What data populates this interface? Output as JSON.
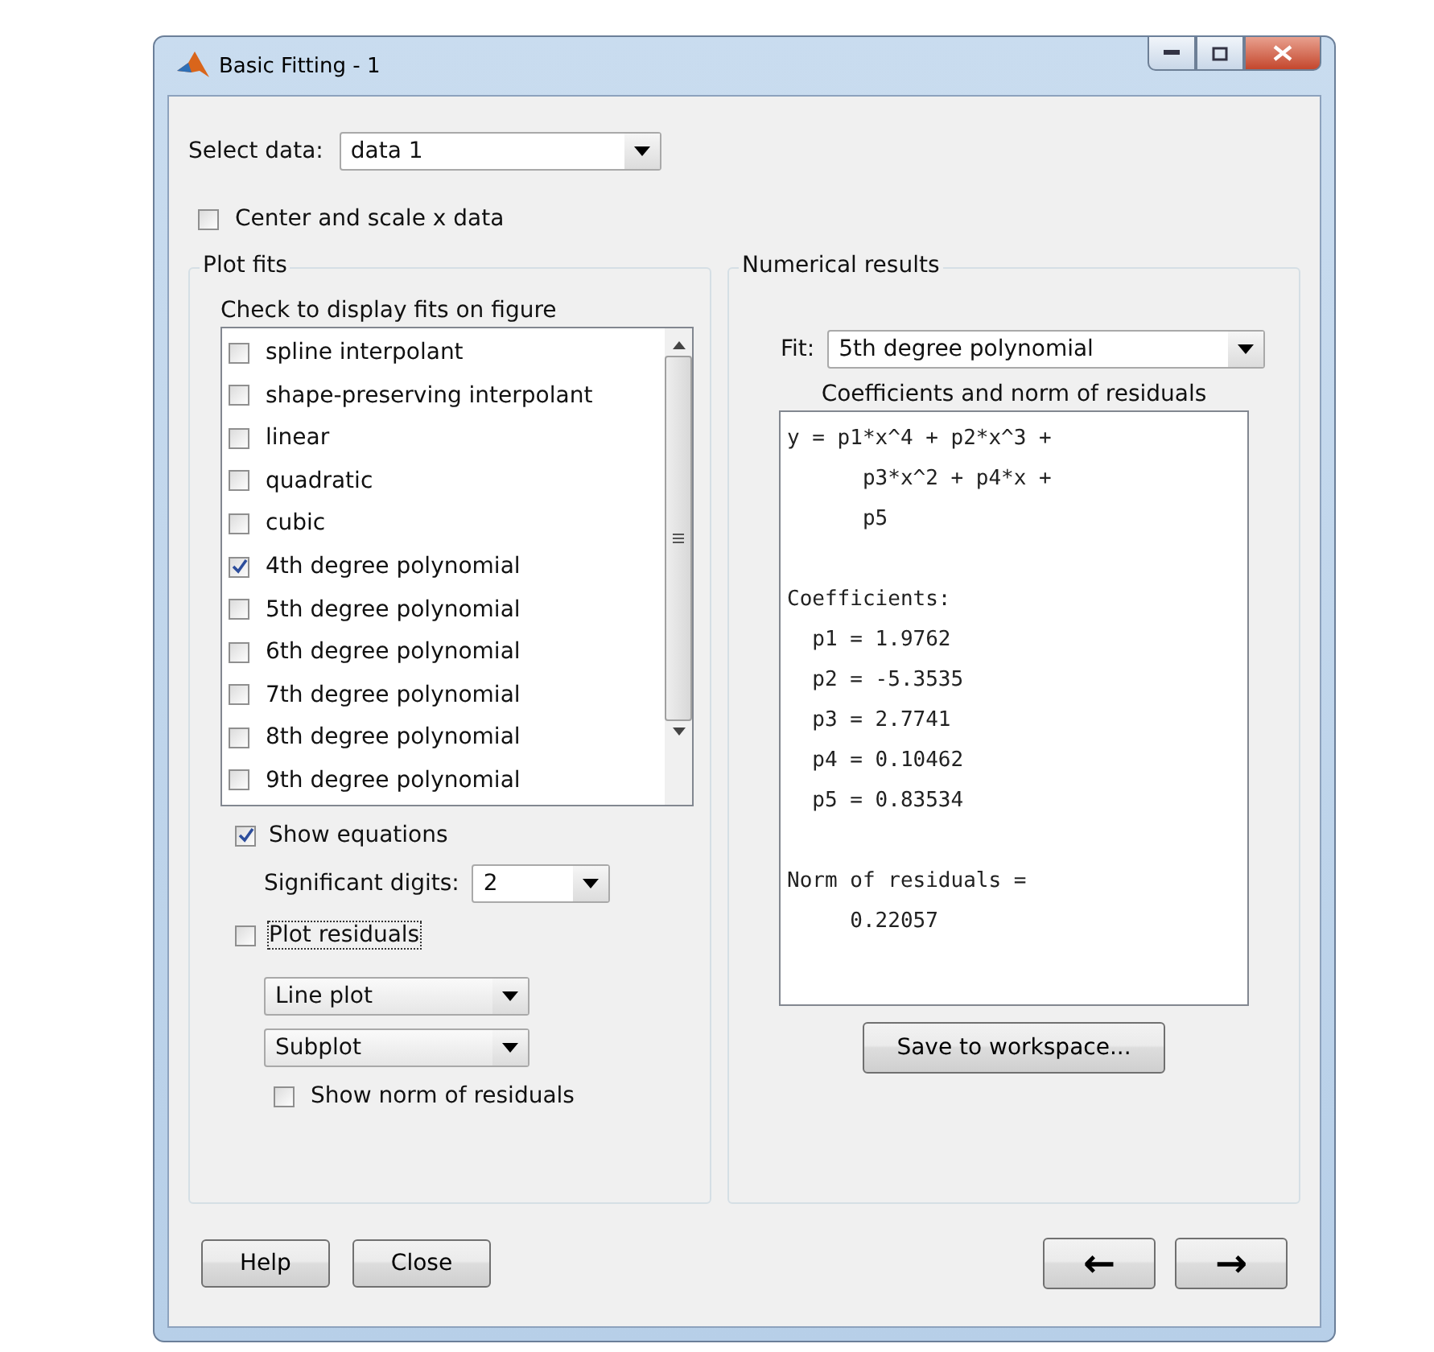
{
  "window": {
    "title": "Basic Fitting - 1"
  },
  "select_data": {
    "label": "Select data:",
    "value": "data 1"
  },
  "center_scale": {
    "label": "Center and scale x data",
    "checked": false
  },
  "plot_fits": {
    "title": "Plot fits",
    "list_label": "Check to display fits on figure",
    "fits": [
      {
        "label": "spline interpolant",
        "checked": false,
        "focused": false
      },
      {
        "label": "shape-preserving interpolant",
        "checked": false,
        "focused": false
      },
      {
        "label": "linear",
        "checked": false,
        "focused": false
      },
      {
        "label": "quadratic",
        "checked": false,
        "focused": false
      },
      {
        "label": "cubic",
        "checked": false,
        "focused": false
      },
      {
        "label": "4th degree polynomial",
        "checked": true,
        "focused": false
      },
      {
        "label": "5th degree polynomial",
        "checked": false,
        "focused": false
      },
      {
        "label": "6th degree polynomial",
        "checked": false,
        "focused": false
      },
      {
        "label": "7th degree polynomial",
        "checked": false,
        "focused": false
      },
      {
        "label": "8th degree polynomial",
        "checked": false,
        "focused": false
      },
      {
        "label": "9th degree polynomial",
        "checked": false,
        "focused": false
      }
    ],
    "show_equations": {
      "label": "Show equations",
      "checked": true
    },
    "significant_digits": {
      "label": "Significant digits:",
      "value": "2"
    },
    "plot_residuals": {
      "label": "Plot residuals",
      "checked": false,
      "focused": true
    },
    "residual_plot_type": "Line plot",
    "residual_location": "Subplot",
    "show_norm": {
      "label": "Show norm of residuals",
      "checked": false
    }
  },
  "numerical_results": {
    "title": "Numerical results",
    "fit_label": "Fit:",
    "fit_value": "5th degree polynomial",
    "results_label": "Coefficients and norm of residuals",
    "blocks": [
      [
        "y = p1*x^4 + p2*x^3 +",
        "      p3*x^2 + p4*x +",
        "      p5"
      ],
      [
        "Coefficients:",
        "  p1 = 1.9762",
        "  p2 = -5.3535",
        "  p3 = 2.7741",
        "  p4 = 0.10462",
        "  p5 = 0.83534"
      ],
      [
        "Norm of residuals =",
        "     0.22057"
      ]
    ],
    "save_button": "Save to workspace..."
  },
  "buttons": {
    "help": "Help",
    "close": "Close",
    "back": "←",
    "forward": "→"
  }
}
